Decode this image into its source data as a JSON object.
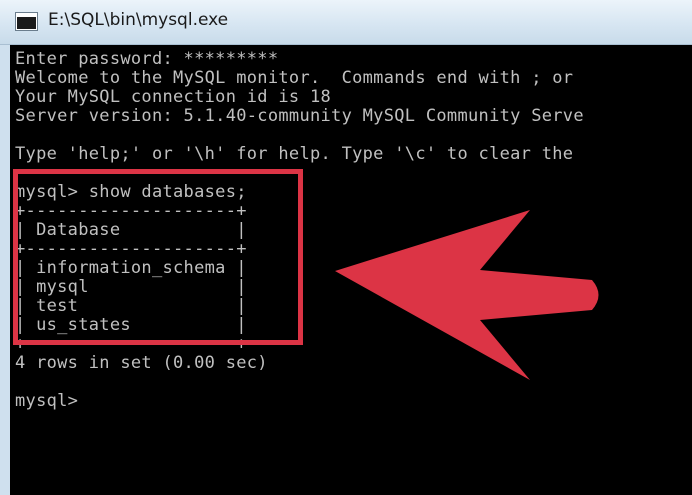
{
  "window": {
    "title": "E:\\SQL\\bin\\mysql.exe"
  },
  "console": {
    "lines": [
      "Enter password: *********",
      "Welcome to the MySQL monitor.  Commands end with ; or",
      "Your MySQL connection id is 18",
      "Server version: 5.1.40-community MySQL Community Serve",
      "",
      "Type 'help;' or '\\h' for help. Type '\\c' to clear the",
      "",
      "mysql> show databases;",
      "+--------------------+",
      "| Database           |",
      "+--------------------+",
      "| information_schema |",
      "| mysql              |",
      "| test               |",
      "| us_states          |",
      "+--------------------+",
      "4 rows in set (0.00 sec)",
      "",
      "mysql>"
    ]
  },
  "annotation": {
    "highlight_color": "#dc3445",
    "arrow_color": "#dc3445"
  },
  "colors": {
    "console_background": "#000000",
    "console_text": "#c0c0c0",
    "titlebar": "#d7e6f2"
  }
}
